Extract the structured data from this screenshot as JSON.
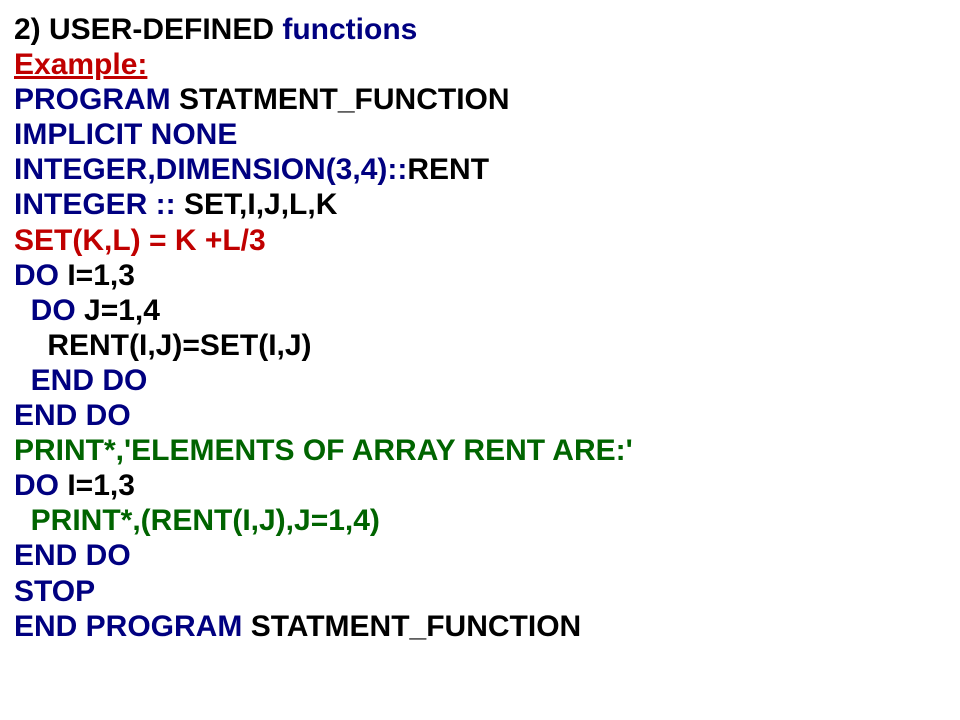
{
  "lines": [
    {
      "parts": [
        {
          "text": "2) USER-DEFINED ",
          "cls": "black"
        },
        {
          "text": "functions",
          "cls": "navy"
        }
      ]
    },
    {
      "parts": [
        {
          "text": "Example:",
          "cls": "red underline"
        }
      ]
    },
    {
      "parts": [
        {
          "text": "PROGRAM ",
          "cls": "navy"
        },
        {
          "text": "STATMENT_FUNCTION",
          "cls": "black"
        }
      ]
    },
    {
      "parts": [
        {
          "text": "IMPLICIT NONE",
          "cls": "navy"
        }
      ]
    },
    {
      "parts": [
        {
          "text": "INTEGER,DIMENSION(3,4)::",
          "cls": "navy"
        },
        {
          "text": "RENT",
          "cls": "black"
        }
      ]
    },
    {
      "parts": [
        {
          "text": "INTEGER :: ",
          "cls": "navy"
        },
        {
          "text": "SET,I,J,L,K",
          "cls": "black"
        }
      ]
    },
    {
      "parts": [
        {
          "text": "SET(K,L) = K +L/3",
          "cls": "red"
        }
      ]
    },
    {
      "parts": [
        {
          "text": "DO ",
          "cls": "navy"
        },
        {
          "text": "I=1,3",
          "cls": "black"
        }
      ]
    },
    {
      "parts": [
        {
          "text": "  ",
          "cls": "black"
        },
        {
          "text": "DO ",
          "cls": "navy"
        },
        {
          "text": "J=1,4",
          "cls": "black"
        }
      ]
    },
    {
      "parts": [
        {
          "text": "    RENT(I,J)=SET(I,J)",
          "cls": "black"
        }
      ]
    },
    {
      "parts": [
        {
          "text": "  ",
          "cls": "black"
        },
        {
          "text": "END DO",
          "cls": "navy"
        }
      ]
    },
    {
      "parts": [
        {
          "text": "END DO",
          "cls": "navy"
        }
      ]
    },
    {
      "parts": [
        {
          "text": "PRINT*,'ELEMENTS OF ARRAY RENT ARE:'",
          "cls": "green"
        }
      ]
    },
    {
      "parts": [
        {
          "text": "DO ",
          "cls": "navy"
        },
        {
          "text": "I=1,3",
          "cls": "black"
        }
      ]
    },
    {
      "parts": [
        {
          "text": "  PRINT*,(RENT(I,J),J=1,4)",
          "cls": "green"
        }
      ]
    },
    {
      "parts": [
        {
          "text": "END DO",
          "cls": "navy"
        }
      ]
    },
    {
      "parts": [
        {
          "text": "STOP",
          "cls": "navy"
        }
      ]
    },
    {
      "parts": [
        {
          "text": "END PROGRAM ",
          "cls": "navy"
        },
        {
          "text": "STATMENT_FUNCTION",
          "cls": "black"
        }
      ]
    }
  ]
}
